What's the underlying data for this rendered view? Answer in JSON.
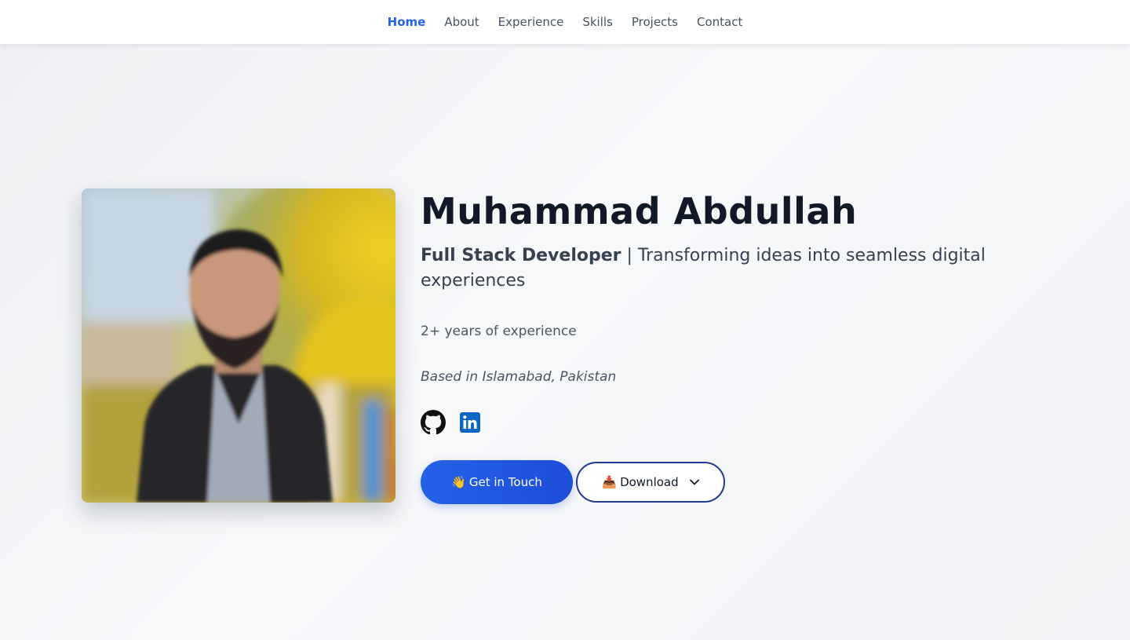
{
  "nav": {
    "items": [
      {
        "label": "Home",
        "active": true
      },
      {
        "label": "About",
        "active": false
      },
      {
        "label": "Experience",
        "active": false
      },
      {
        "label": "Skills",
        "active": false
      },
      {
        "label": "Projects",
        "active": false
      },
      {
        "label": "Contact",
        "active": false
      }
    ],
    "active_color": "#2463eb"
  },
  "hero": {
    "name": "Muhammad Abdullah",
    "role": "Full Stack Developer",
    "separator": " | ",
    "tagline": "Transforming ideas into seamless digital experiences",
    "experience": "2+ years of experience",
    "location": "Based in Islamabad, Pakistan",
    "socials": [
      {
        "icon": "github-icon"
      },
      {
        "icon": "linkedin-icon",
        "color": "#0a66c2"
      }
    ],
    "buttons": {
      "get_in_touch_emoji": "👋",
      "get_in_touch_label": "Get in Touch",
      "download_emoji": "📥",
      "download_label": "Download"
    },
    "accent": "#1d4ed8"
  }
}
